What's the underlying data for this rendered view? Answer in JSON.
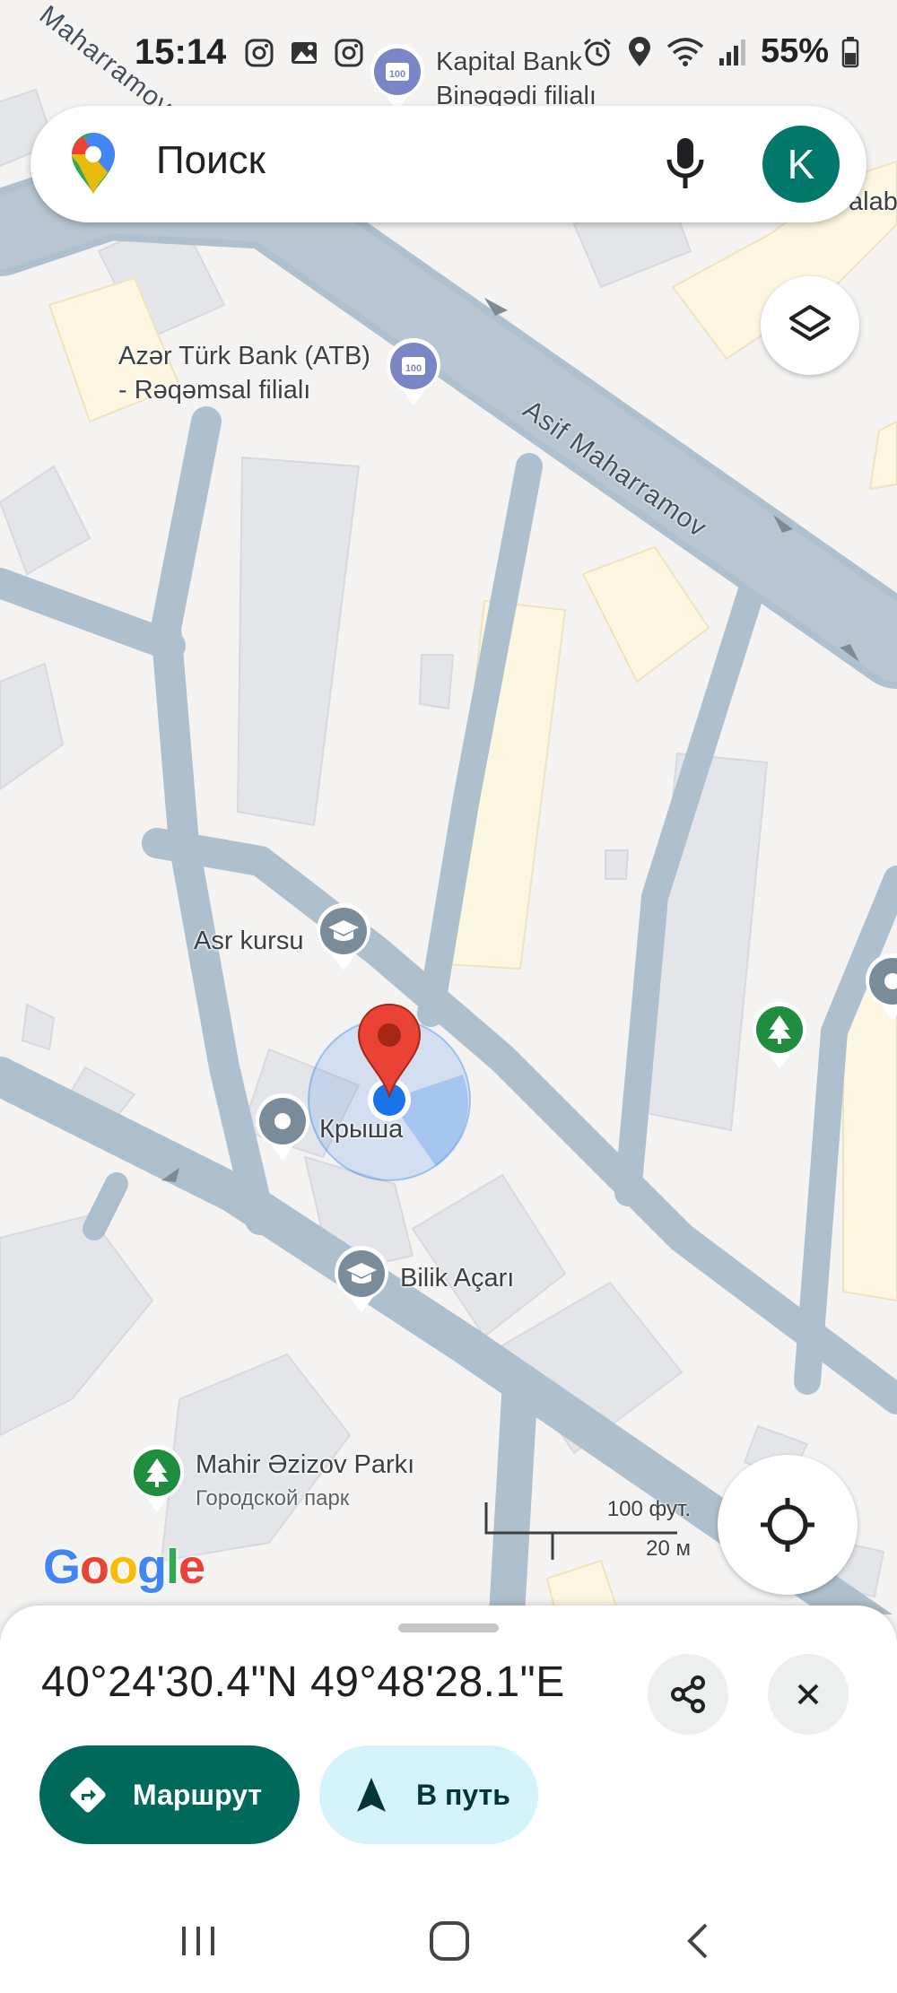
{
  "status_bar": {
    "time": "15:14",
    "battery": "55%",
    "left_icons": [
      "instagram-icon",
      "gallery-icon",
      "instagram-icon"
    ],
    "right_icons": [
      "alarm-icon",
      "location-icon",
      "wifi-icon",
      "signal-icon",
      "battery-icon"
    ]
  },
  "search": {
    "placeholder": "Поиск",
    "avatar_letter": "K",
    "avatar_color": "#00796b"
  },
  "map": {
    "labels": {
      "kapital_bank_line1": "Kapital Bank",
      "kapital_bank_line2": "Binəqədi filialı",
      "azer_turk_line1": "Azər Türk Bank (ATB)",
      "azer_turk_line2": "- Rəqəmsal filialı",
      "street_asif": "Asif Maharramov",
      "street_top_left": "Maharramov",
      "asr_kursu": "Asr kursu",
      "krysha": "Крыша",
      "bilik_acari": "Bilik Açarı",
      "park_name": "Mahir Əzizov Parkı",
      "park_type": "Городской парк",
      "edge_label": "alab"
    },
    "scale": {
      "feet": "100 фут.",
      "meters": "20 м"
    },
    "google_logo": [
      "G",
      "o",
      "o",
      "g",
      "l",
      "e"
    ],
    "colors": {
      "road": "#aebfcd",
      "building": "#e3e5e8",
      "commercial": "#fdf6e1",
      "pin_red": "#ea4335",
      "location_blue": "#1a73e8",
      "park_green": "#1e8e3e"
    }
  },
  "sheet": {
    "coordinates": "40°24'30.4\"N 49°48'28.1\"E",
    "route_label": "Маршрут",
    "go_label": "В путь"
  }
}
